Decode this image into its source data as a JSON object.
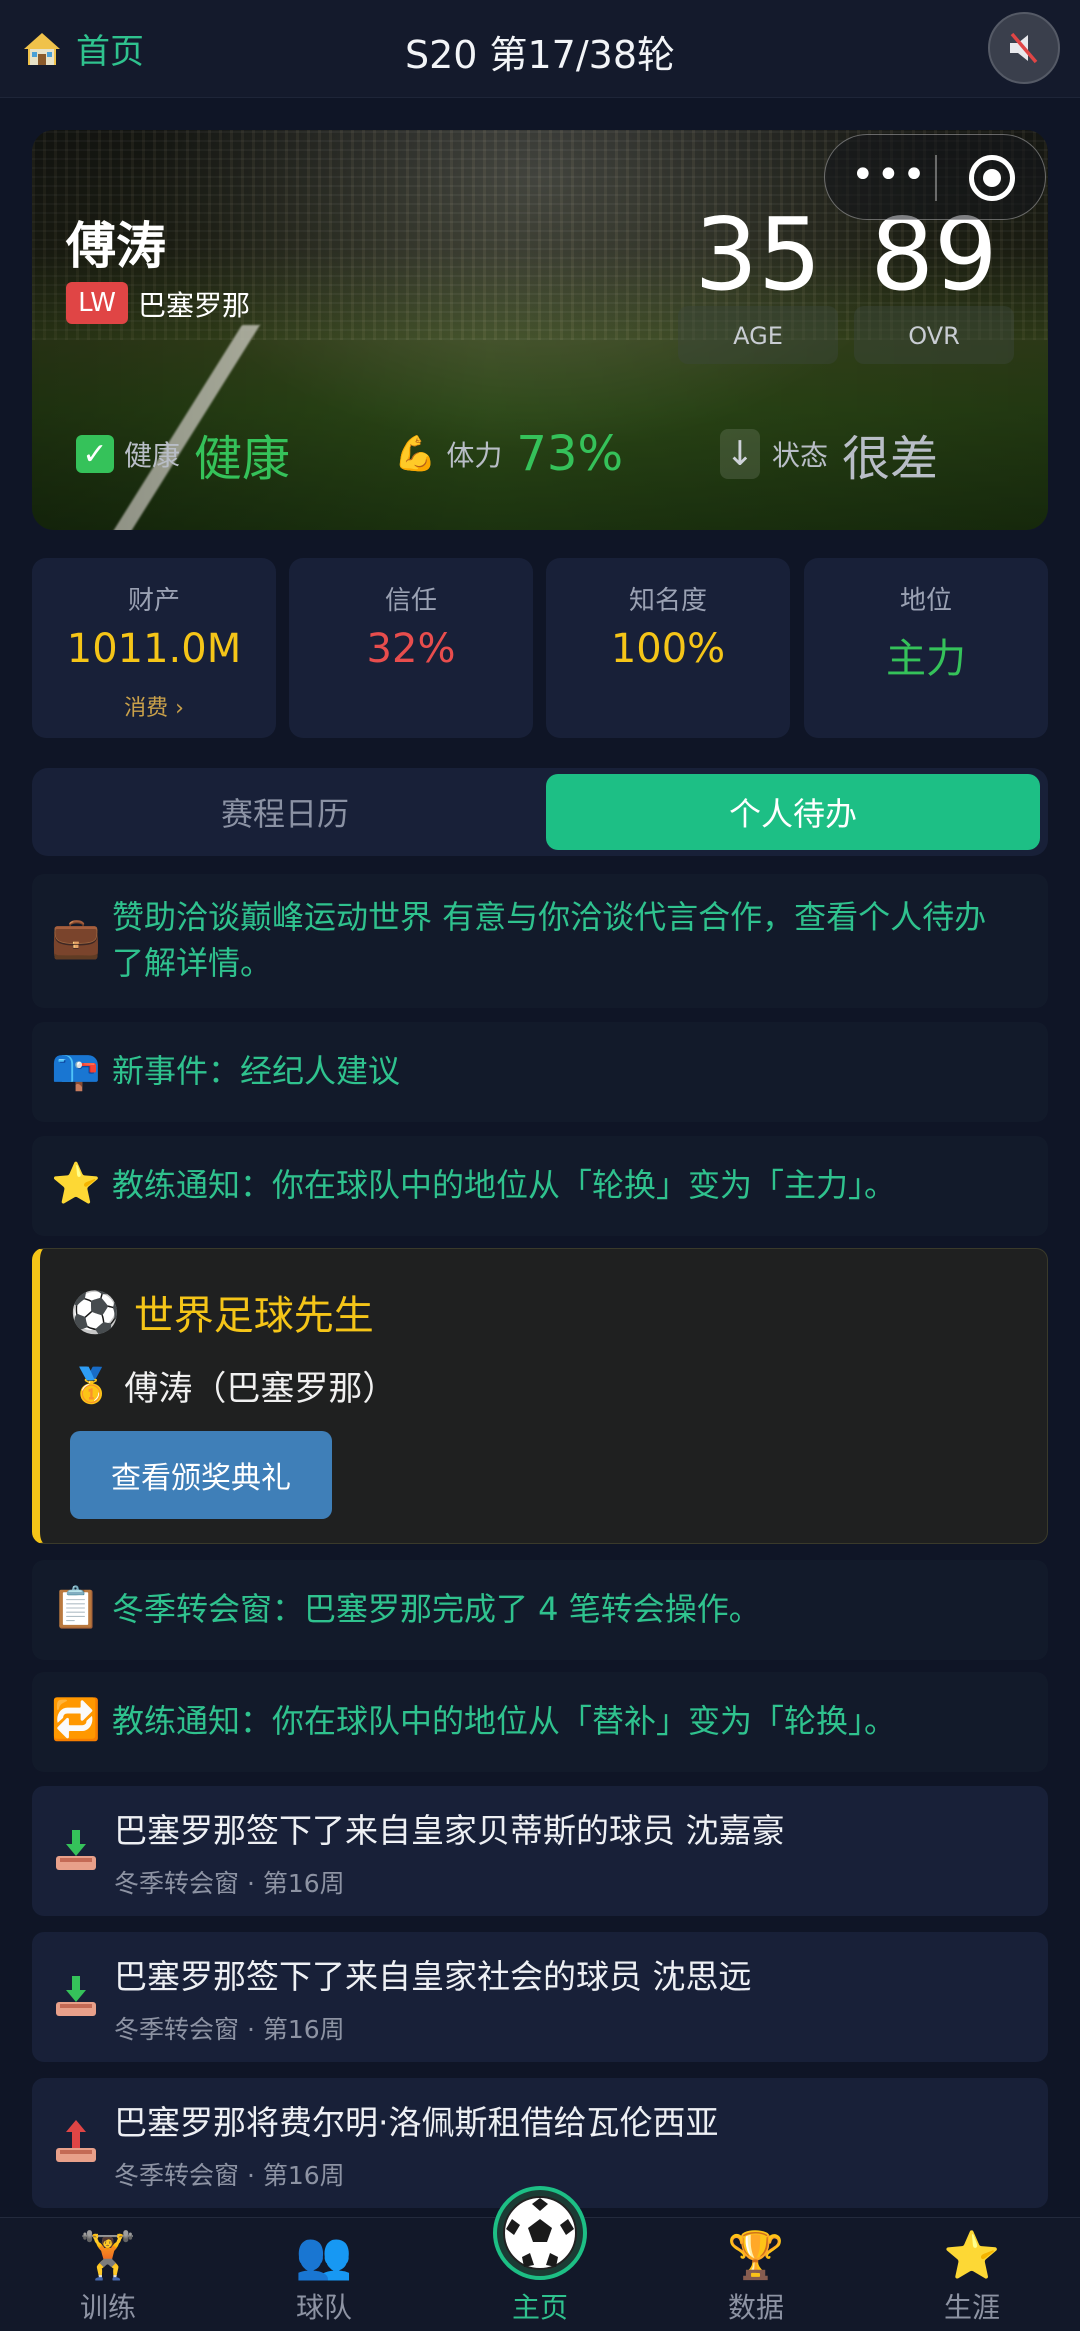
{
  "topbar": {
    "home_label": "首页",
    "title": "S20 第17/38轮"
  },
  "hero": {
    "player_name": "傅涛",
    "position": "LW",
    "team": "巴塞罗那",
    "age": "35",
    "age_label": "AGE",
    "ovr": "89",
    "ovr_label": "OVR",
    "health_label": "健康",
    "health_value": "健康",
    "stamina_label": "体力",
    "stamina_value": "73%",
    "form_label": "状态",
    "form_value": "很差",
    "colors": {
      "health": "#35c25a",
      "stamina": "#35c25a",
      "form": "#b9bec7"
    }
  },
  "stats": [
    {
      "title": "财产",
      "value": "1011.0M",
      "sub": "消费 ›",
      "color": "#f5c518"
    },
    {
      "title": "信任",
      "value": "32%",
      "color": "#e84d4d"
    },
    {
      "title": "知名度",
      "value": "100%",
      "color": "#f5c518"
    },
    {
      "title": "地位",
      "value": "主力",
      "color": "#35c25a"
    }
  ],
  "tabs": {
    "calendar": "赛程日历",
    "todo": "个人待办"
  },
  "feed": [
    {
      "icon": "briefcase-icon",
      "text": "赞助洽谈巅峰运动世界 有意与你洽谈代言合作，查看个人待办了解详情。"
    },
    {
      "icon": "mailbox-icon",
      "text": "新事件：经纪人建议"
    },
    {
      "icon": "star-icon",
      "text": "教练通知：你在球队中的地位从「轮换」变为「主力」。"
    }
  ],
  "award": {
    "title": "世界足球先生",
    "winner": "傅涛（巴塞罗那）",
    "button": "查看颁奖典礼"
  },
  "feed2": [
    {
      "icon": "clipboard-icon",
      "text": "冬季转会窗：巴塞罗那完成了 4 笔转会操作。"
    },
    {
      "icon": "repeat-icon",
      "text": "教练通知：你在球队中的地位从「替补」变为「轮换」。"
    }
  ],
  "news": [
    {
      "icon": "transfer-in-icon",
      "title": "巴塞罗那签下了来自皇家贝蒂斯的球员 沈嘉豪",
      "sub": "冬季转会窗 · 第16周"
    },
    {
      "icon": "transfer-in-icon",
      "title": "巴塞罗那签下了来自皇家社会的球员 沈思远",
      "sub": "冬季转会窗 · 第16周"
    },
    {
      "icon": "transfer-out-icon",
      "title": "巴塞罗那将费尔明·洛佩斯租借给瓦伦西亚",
      "sub": "冬季转会窗 · 第16周"
    }
  ],
  "bottomnav": [
    {
      "label": "训练",
      "icon": "weightlifter-icon"
    },
    {
      "label": "球队",
      "icon": "team-icon"
    },
    {
      "label": "主页",
      "icon": "soccer-ball-icon"
    },
    {
      "label": "数据",
      "icon": "trophy-icon"
    },
    {
      "label": "生涯",
      "icon": "star-icon"
    }
  ]
}
